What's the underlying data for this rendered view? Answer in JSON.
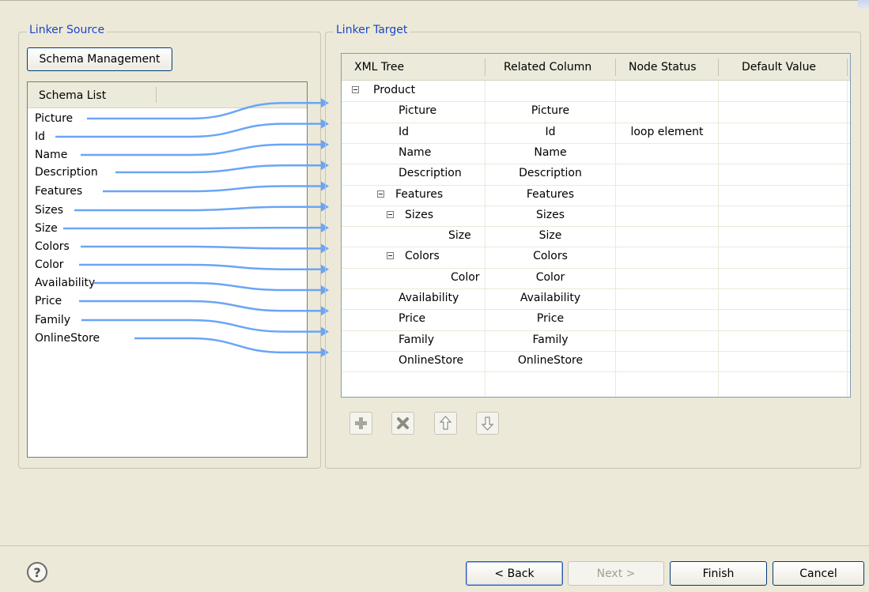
{
  "linker_source": {
    "title": "Linker Source",
    "schema_management_label": "Schema Management",
    "schema_list_header": "Schema List",
    "items": [
      "Picture",
      "Id",
      "Name",
      "Description",
      "Features",
      "Sizes",
      "Size",
      "Colors",
      "Color",
      "Availability",
      "Price",
      "Family",
      "OnlineStore"
    ]
  },
  "linker_target": {
    "title": "Linker Target",
    "columns": [
      "XML Tree",
      "Related Column",
      "Node Status",
      "Default Value"
    ],
    "rows": [
      {
        "node": "Product",
        "related": "",
        "status": "",
        "default": ""
      },
      {
        "node": "Picture",
        "related": "Picture",
        "status": "",
        "default": ""
      },
      {
        "node": "Id",
        "related": "Id",
        "status": "loop element",
        "default": ""
      },
      {
        "node": "Name",
        "related": "Name",
        "status": "",
        "default": ""
      },
      {
        "node": "Description",
        "related": "Description",
        "status": "",
        "default": ""
      },
      {
        "node": "Features",
        "related": "Features",
        "status": "",
        "default": ""
      },
      {
        "node": "Sizes",
        "related": "Sizes",
        "status": "",
        "default": ""
      },
      {
        "node": "Size",
        "related": "Size",
        "status": "",
        "default": ""
      },
      {
        "node": "Colors",
        "related": "Colors",
        "status": "",
        "default": ""
      },
      {
        "node": "Color",
        "related": "Color",
        "status": "",
        "default": ""
      },
      {
        "node": "Availability",
        "related": "Availability",
        "status": "",
        "default": ""
      },
      {
        "node": "Price",
        "related": "Price",
        "status": "",
        "default": ""
      },
      {
        "node": "Family",
        "related": "Family",
        "status": "",
        "default": ""
      },
      {
        "node": "OnlineStore",
        "related": "OnlineStore",
        "status": "",
        "default": ""
      }
    ],
    "toolbar": [
      "add-icon",
      "delete-icon",
      "move-up-icon",
      "move-down-icon"
    ]
  },
  "footer": {
    "help_icon": "help-icon",
    "back_label": "< Back",
    "next_label": "Next >",
    "finish_label": "Finish",
    "cancel_label": "Cancel"
  },
  "colors": {
    "link_line": "#6aa5f5",
    "group_title": "#1a47c4",
    "dialog_bg": "#ece9d8"
  }
}
